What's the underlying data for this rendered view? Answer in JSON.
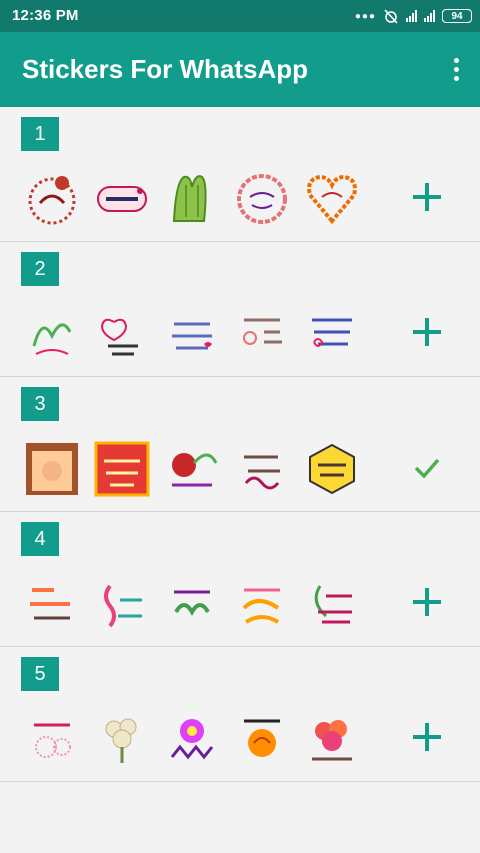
{
  "status": {
    "time": "12:36 PM",
    "battery": "94"
  },
  "appbar": {
    "title": "Stickers For WhatsApp",
    "menu_icon": "more-vert-icon"
  },
  "colors": {
    "primary": "#129c8b",
    "status": "#127a6c",
    "check": "#4caf50"
  },
  "packs": [
    {
      "number": "1",
      "action": "add",
      "action_icon": "plus-icon"
    },
    {
      "number": "2",
      "action": "add",
      "action_icon": "plus-icon"
    },
    {
      "number": "3",
      "action": "added",
      "action_icon": "check-icon"
    },
    {
      "number": "4",
      "action": "add",
      "action_icon": "plus-icon"
    },
    {
      "number": "5",
      "action": "add",
      "action_icon": "plus-icon"
    }
  ]
}
